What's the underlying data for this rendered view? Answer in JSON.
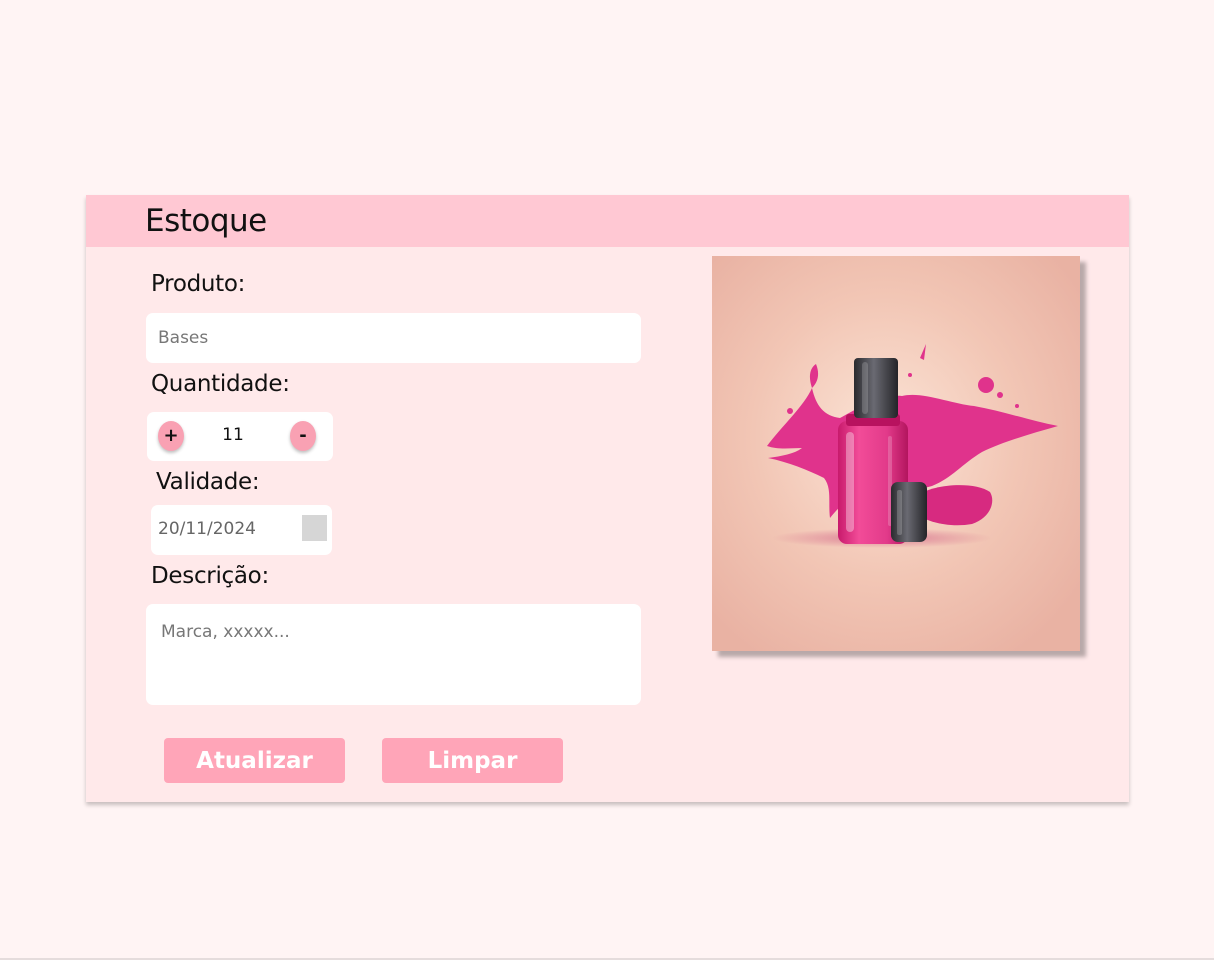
{
  "header": {
    "title": "Estoque"
  },
  "form": {
    "product": {
      "label": "Produto:",
      "value": "Bases"
    },
    "quantity": {
      "label": "Quantidade:",
      "plus_label": "+",
      "value": "11",
      "minus_label": "-"
    },
    "expiry": {
      "label": "Validade:",
      "value": "20/11/2024",
      "picker_icon": "calendar-icon"
    },
    "description": {
      "label": "Descrição:",
      "placeholder": "Marca, xxxxx..."
    }
  },
  "actions": {
    "update_label": "Atualizar",
    "clear_label": "Limpar"
  },
  "image": {
    "subject": "nail-polish-splash-illustration"
  },
  "colors": {
    "page_background": "#fff4f4",
    "card_background": "#ffe9ea",
    "header_background": "#ffc8d3",
    "button_background": "#ffa5b8",
    "stepper_button": "#f9a1b3",
    "polish_pink": "#e23d8e"
  }
}
